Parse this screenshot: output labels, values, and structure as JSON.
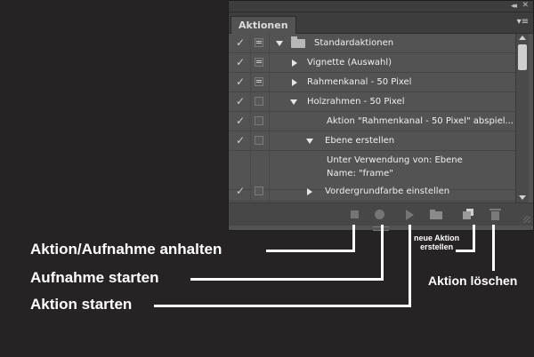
{
  "panel": {
    "tab_label": "Aktionen",
    "rows": [
      {
        "checked": true,
        "dialog": true,
        "toggle": "expanded",
        "folder": true,
        "label": "Standardaktionen"
      },
      {
        "checked": true,
        "dialog": true,
        "toggle": "collapsed",
        "label": "Vignette (Auswahl)"
      },
      {
        "checked": true,
        "dialog": true,
        "toggle": "collapsed",
        "label": "Rahmenkanal - 50 Pixel"
      },
      {
        "checked": true,
        "dialog": false,
        "toggle": "expanded",
        "label": "Holzrahmen - 50 Pixel"
      },
      {
        "checked": true,
        "dialog": false,
        "toggle": "none",
        "label": "Aktion \"Rahmenkanal - 50 Pixel\" abspiel..."
      },
      {
        "checked": true,
        "dialog": false,
        "toggle": "expanded",
        "label": "Ebene erstellen"
      },
      {
        "checked": false,
        "dialog": false,
        "toggle": "none",
        "label": "Unter Verwendung von: Ebene",
        "label2": "Name:  \"frame\""
      },
      {
        "checked": true,
        "dialog": false,
        "toggle": "collapsed",
        "label": "Vordergrundfarbe einstellen"
      }
    ],
    "check_glyph": "✓",
    "collapse_glyph": "◂◂",
    "close_glyph": "✕",
    "menu_glyph": "▾≡",
    "buttons": [
      "stop-icon",
      "record-icon",
      "play-icon",
      "new-set-icon",
      "new-action-icon",
      "trash-icon"
    ]
  },
  "annotations": {
    "stop": "Aktion/Aufnahme anhalten",
    "record": "Aufnahme starten",
    "play": "Aktion starten",
    "new_action_line1": "neue Aktion",
    "new_action_line2": "erstellen",
    "delete": "Aktion löschen"
  }
}
